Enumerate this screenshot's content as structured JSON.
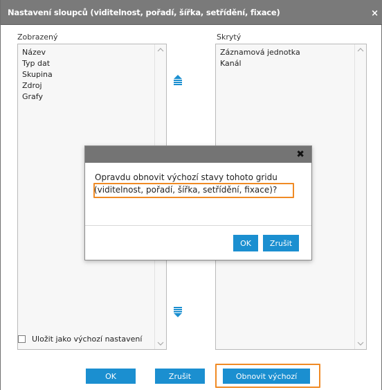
{
  "dialog": {
    "title": "Nastavení sloupců (viditelnost, pořadí, šířka, setřídění, fixace)",
    "close_glyph": "×"
  },
  "visible_column": {
    "label": "Zobrazený",
    "items": [
      "Název",
      "Typ dat",
      "Skupina",
      "Zdroj",
      "Grafy"
    ]
  },
  "hidden_column": {
    "label": "Skrytý",
    "items": [
      "Záznamová jednotka",
      "Kanál"
    ]
  },
  "move_controls": {
    "up_icon": "move-up-icon",
    "down_icon": "move-down-icon",
    "color": "#1b8fd0"
  },
  "footer": {
    "save_default_label": "Uložit jako výchozí nastavení",
    "ok_label": "OK",
    "cancel_label": "Zrušit",
    "restore_label": "Obnovit výchozí"
  },
  "confirm_modal": {
    "close_glyph": "✖",
    "message_line1": "Opravdu obnovit výchozí stavy tohoto gridu",
    "message_line2": "(viditelnost, pořadí, šířka, setřídění, fixace)?",
    "ok_label": "OK",
    "cancel_label": "Zrušit"
  },
  "colors": {
    "accent": "#1b8fd0",
    "highlight": "#f08a24",
    "titlebar": "#7a7a7a"
  }
}
